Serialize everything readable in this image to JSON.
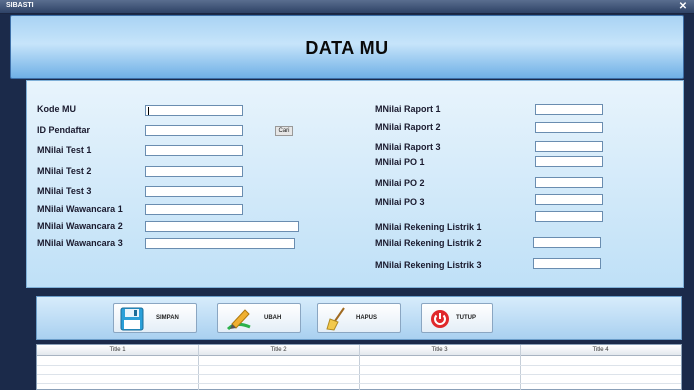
{
  "window": {
    "title": "SIBASTI",
    "close_glyph": "✕"
  },
  "header": {
    "title": "DATA MU"
  },
  "form": {
    "left_labels": [
      "Kode MU",
      "ID Pendaftar",
      "MNilai Test 1",
      "MNilai Test 2",
      "MNilai Test 3",
      "MNilai Wawancara 1",
      "MNilai Wawancara 2",
      "MNilai Wawancara 3"
    ],
    "right_labels": [
      "MNilai Raport 1",
      "MNilai Raport 2",
      "MNilai Raport 3",
      "MNilai PO 1",
      "MNilai PO 2",
      "MNilai PO 3",
      "MNilai Rekening Listrik 1",
      "MNilai Rekening Listrik 2",
      "MNilai Rekening Listrik 3"
    ],
    "cari_label": "Cari"
  },
  "buttons": {
    "simpan": "SIMPAN",
    "ubah": "UBAH",
    "hapus": "HAPUS",
    "tutup": "TUTUP"
  },
  "table": {
    "columns": [
      "Title 1",
      "Title 2",
      "Title 3",
      "Title 4"
    ]
  },
  "colors": {
    "accent": "#6fb0e6",
    "frame": "#1b2a4a",
    "danger": "#e0282b"
  }
}
